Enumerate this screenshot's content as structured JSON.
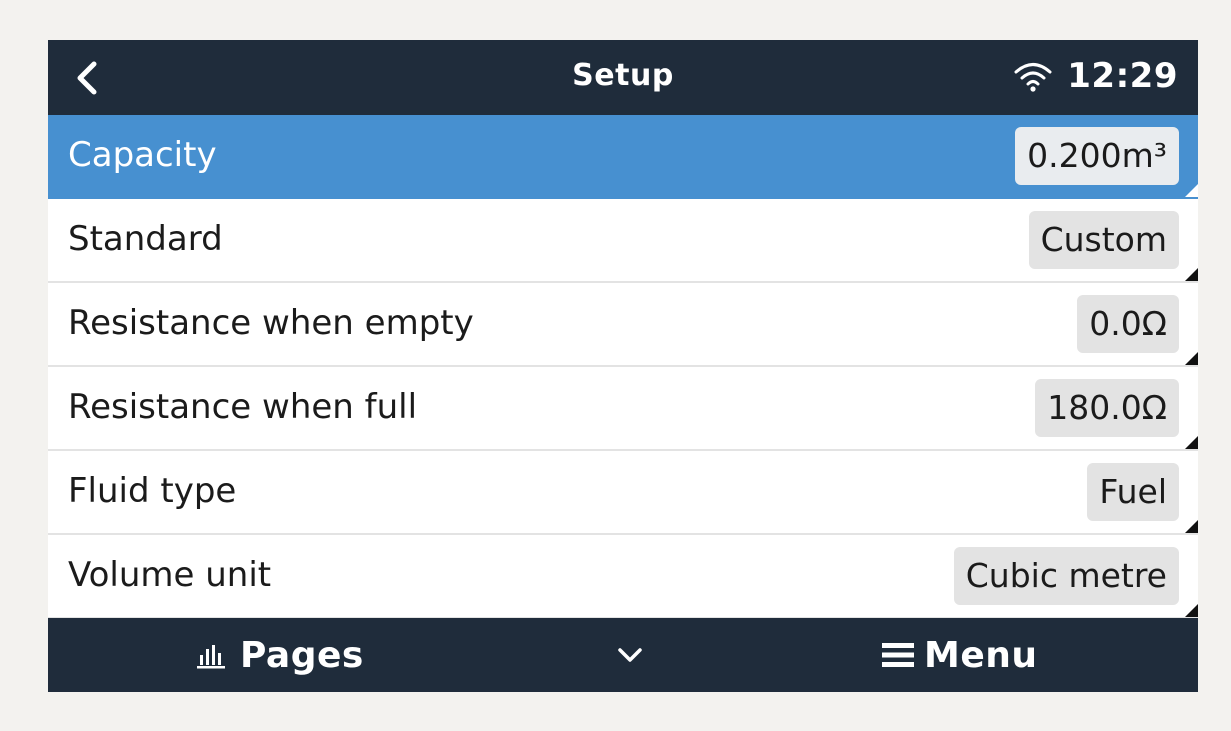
{
  "header": {
    "title": "Setup",
    "time": "12:29",
    "back_icon": "chevron-left-icon",
    "wifi_icon": "wifi-icon"
  },
  "rows": [
    {
      "label": "Capacity",
      "value": "0.200m³",
      "selected": true
    },
    {
      "label": "Standard",
      "value": "Custom",
      "selected": false
    },
    {
      "label": "Resistance when empty",
      "value": "0.0Ω",
      "selected": false
    },
    {
      "label": "Resistance when full",
      "value": "180.0Ω",
      "selected": false
    },
    {
      "label": "Fluid type",
      "value": "Fuel",
      "selected": false
    },
    {
      "label": "Volume unit",
      "value": "Cubic metre",
      "selected": false
    }
  ],
  "footer": {
    "pages_label": "Pages",
    "menu_label": "Menu",
    "pages_icon": "bar-chart-icon",
    "down_icon": "chevron-down-icon",
    "menu_icon": "hamburger-menu-icon"
  },
  "colors": {
    "bar": "#1f2c3b",
    "selected": "#4790d0",
    "value_box": "#e3e3e3"
  }
}
